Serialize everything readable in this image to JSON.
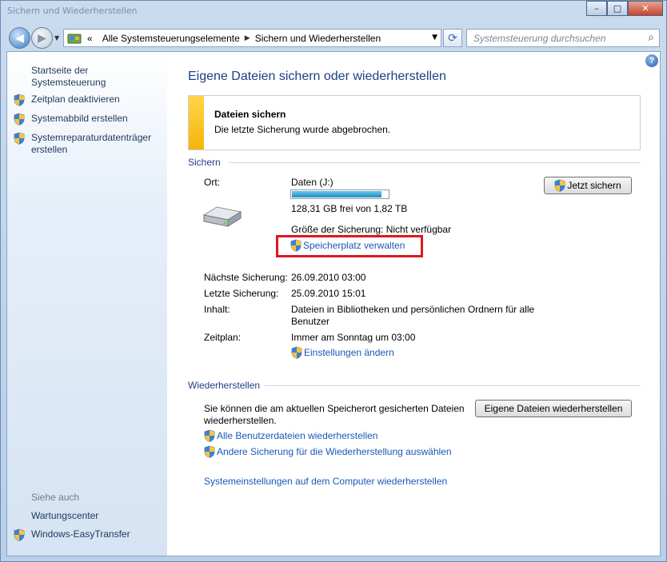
{
  "window": {
    "title": "Sichern und Wiederherstellen"
  },
  "window_buttons": {
    "minimize": "–",
    "maximize": "□",
    "close": "✕"
  },
  "address": {
    "chevron": "«",
    "segments": [
      "Alle Systemsteuerungselemente",
      "Sichern und Wiederherstellen"
    ]
  },
  "search": {
    "placeholder": "Systemsteuerung durchsuchen"
  },
  "sidebar": {
    "home": "Startseite der Systemsteuerung",
    "items": [
      {
        "label": "Zeitplan deaktivieren"
      },
      {
        "label": "Systemabbild erstellen"
      },
      {
        "label": "Systemreparaturdatenträger erstellen"
      }
    ],
    "see_also_label": "Siehe auch",
    "see_also": [
      {
        "label": "Wartungscenter"
      },
      {
        "label": "Windows-EasyTransfer"
      }
    ]
  },
  "main": {
    "title": "Eigene Dateien sichern oder wiederherstellen",
    "notice": {
      "heading": "Dateien sichern",
      "text": "Die letzte Sicherung wurde abgebrochen."
    },
    "backup": {
      "section": "Sichern",
      "location_label": "Ort:",
      "location_value": "Daten (J:)",
      "free_space": "128,31 GB frei von 1,82 TB",
      "used_fraction": 0.93,
      "backup_size": "Größe der Sicherung: Nicht verfügbar",
      "manage_space": "Speicherplatz verwalten",
      "backup_now": "Jetzt sichern",
      "next_label": "Nächste Sicherung:",
      "next_value": "26.09.2010 03:00",
      "last_label": "Letzte Sicherung:",
      "last_value": "25.09.2010 15:01",
      "content_label": "Inhalt:",
      "content_value": "Dateien in Bibliotheken und persönlichen Ordnern für alle Benutzer",
      "schedule_label": "Zeitplan:",
      "schedule_value": "Immer am Sonntag um 03:00",
      "change_settings": "Einstellungen ändern"
    },
    "restore": {
      "section": "Wiederherstellen",
      "text": "Sie können die am aktuellen Speicherort gesicherten Dateien wiederherstellen.",
      "restore_button": "Eigene Dateien wiederherstellen",
      "all_users": "Alle Benutzerdateien wiederherstellen",
      "other_backup": "Andere Sicherung für die Wiederherstellung auswählen",
      "system_settings": "Systemeinstellungen auf dem Computer wiederherstellen"
    }
  },
  "colors": {
    "link": "#1a58b6",
    "title": "#1e3f84",
    "notice_bar": "#f5b50a",
    "highlight": "#e0161e"
  }
}
